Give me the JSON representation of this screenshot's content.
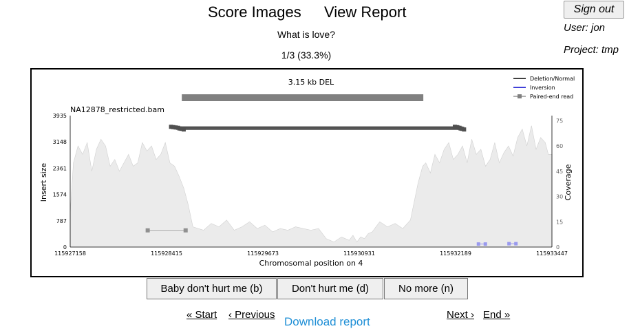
{
  "nav": {
    "score_label": "Score Images",
    "report_label": "View Report"
  },
  "account": {
    "signout_label": "Sign out",
    "user_text": "User: jon",
    "project_text": "Project: tmp"
  },
  "question": "What is love?",
  "progress_text": "1/3 (33.3%)",
  "chart_data": {
    "type": "area",
    "title": "3.15 kb DEL",
    "sample_label": "NA12878_restricted.bam",
    "xlabel": "Chromosomal position on 4",
    "ylabel_left": "Insert size",
    "ylabel_right": "Coverage",
    "x_ticks": [
      "115927158",
      "115928415",
      "115929673",
      "115930931",
      "115932189",
      "115933447"
    ],
    "xlim": [
      115927158,
      115933447
    ],
    "y_left_ticks": [
      "0",
      "787",
      "1574",
      "2361",
      "3148",
      "3935"
    ],
    "y_left_lim": [
      0,
      3935
    ],
    "y_right_ticks": [
      "0",
      "15",
      "30",
      "45",
      "60",
      "75"
    ],
    "y_right_lim": [
      0,
      78
    ],
    "legend": [
      "Deletion/Normal",
      "Inversion",
      "Paired-end read"
    ],
    "legend_placement": "top-right",
    "deletion": {
      "start": 115928615,
      "end": 115931768
    },
    "coverage_profile": {
      "x": [
        115927158,
        115927200,
        115927260,
        115927320,
        115927380,
        115927440,
        115927500,
        115927560,
        115927620,
        115927680,
        115927740,
        115927800,
        115927860,
        115927920,
        115927980,
        115928040,
        115928100,
        115928160,
        115928220,
        115928280,
        115928340,
        115928400,
        115928460,
        115928520,
        115928580,
        115928640,
        115928700,
        115928760,
        115928900,
        115929000,
        115929100,
        115929200,
        115929300,
        115929400,
        115929500,
        115929600,
        115929700,
        115929800,
        115929900,
        115930000,
        115930100,
        115930200,
        115930300,
        115930400,
        115930500,
        115930600,
        115930700,
        115930800,
        115930850,
        115930900,
        115930950,
        115931000,
        115931050,
        115931100,
        115931150,
        115931200,
        115931300,
        115931400,
        115931500,
        115931600,
        115931700,
        115931760,
        115931800,
        115931860,
        115931920,
        115931980,
        115932040,
        115932100,
        115932160,
        115932220,
        115932280,
        115932340,
        115932400,
        115932460,
        115932520,
        115932580,
        115932640,
        115932700,
        115932760,
        115932820,
        115932880,
        115932940,
        115933000,
        115933060,
        115933120,
        115933180,
        115933240,
        115933300,
        115933360,
        115933400,
        115933447
      ],
      "coverage": [
        20,
        50,
        60,
        55,
        62,
        45,
        58,
        64,
        60,
        48,
        52,
        45,
        50,
        55,
        48,
        50,
        62,
        57,
        60,
        52,
        55,
        62,
        50,
        48,
        42,
        35,
        25,
        12,
        10,
        14,
        12,
        16,
        10,
        12,
        15,
        11,
        13,
        9,
        11,
        10,
        12,
        11,
        10,
        11,
        5,
        3,
        6,
        4,
        7,
        3,
        6,
        5,
        8,
        9,
        12,
        15,
        12,
        14,
        11,
        16,
        38,
        48,
        50,
        44,
        55,
        50,
        58,
        62,
        52,
        55,
        60,
        50,
        64,
        55,
        58,
        48,
        52,
        62,
        50,
        56,
        60,
        54,
        65,
        70,
        60,
        72,
        58,
        65,
        62,
        55,
        55
      ]
    },
    "paired_reads": [
      {
        "x1": 115928475,
        "x2": 115932180,
        "insert_size": 3600
      },
      {
        "x1": 115928505,
        "x2": 115932205,
        "insert_size": 3590
      },
      {
        "x1": 115928535,
        "x2": 115932215,
        "insert_size": 3580
      },
      {
        "x1": 115928565,
        "x2": 115932240,
        "insert_size": 3570
      },
      {
        "x1": 115928585,
        "x2": 115932255,
        "insert_size": 3550
      },
      {
        "x1": 115928610,
        "x2": 115932275,
        "insert_size": 3540
      },
      {
        "x1": 115928640,
        "x2": 115932300,
        "insert_size": 3520
      },
      {
        "x1": 115928170,
        "x2": 115928665,
        "insert_size": 500
      }
    ],
    "inversion_reads": [
      {
        "x1": 115932488,
        "x2": 115932578,
        "insert_size": 90
      },
      {
        "x1": 115932887,
        "x2": 115932977,
        "insert_size": 100
      }
    ],
    "colors": {
      "coverage_fill": "#ebebeb",
      "coverage_line": "#d0d0d0",
      "deletion_bar": "#808080",
      "inversion": "#0000cc",
      "read": "#505050",
      "inversion_points": "#9999ee"
    }
  },
  "choices": {
    "baby_label": "Baby don't hurt me (b)",
    "dont_label": "Don't hurt me (d)",
    "nomore_label": "No more (n)"
  },
  "pager": {
    "start_label": "« Start",
    "prev_label": "‹ Previous",
    "download_label": "Download report",
    "next_label": "Next ›",
    "end_label": "End »"
  }
}
